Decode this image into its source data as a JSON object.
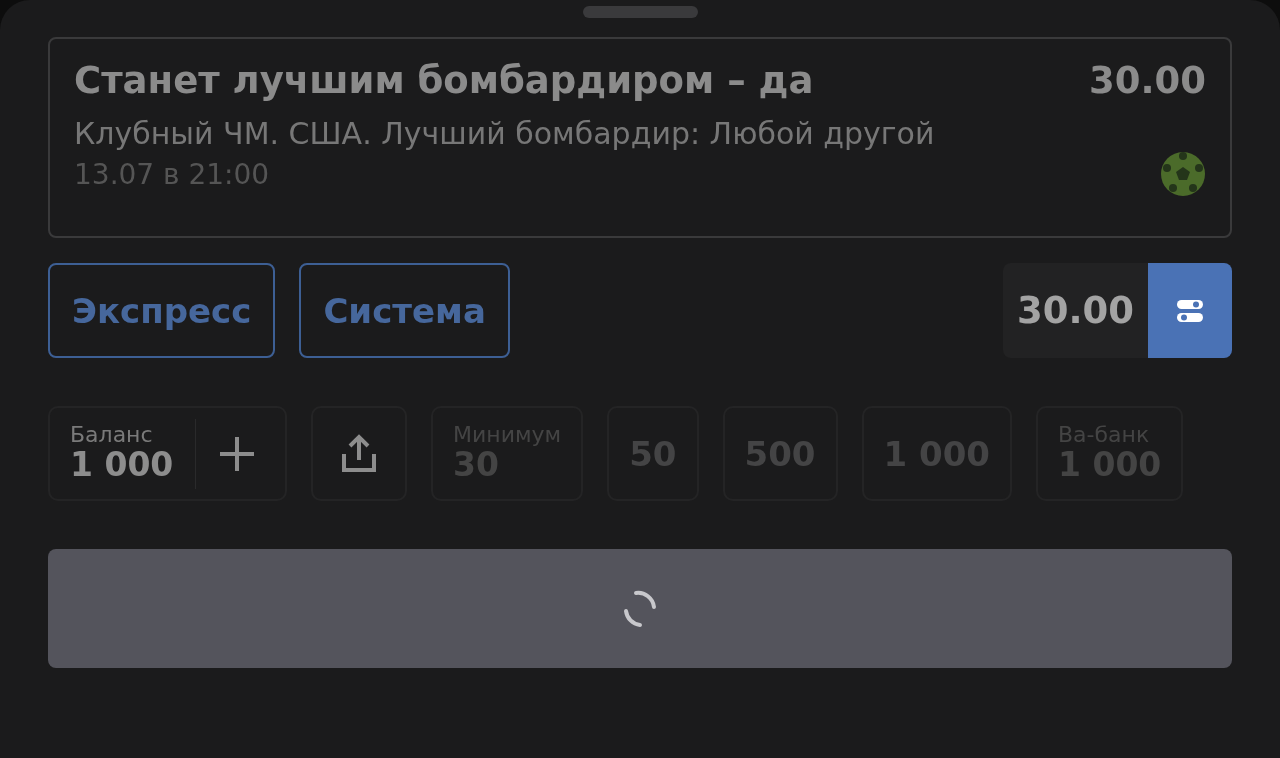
{
  "bet": {
    "title": "Станет лучшим бомбардиром – да",
    "odds": "30.00",
    "event": "Клубный ЧМ. США. Лучший бомбардир: Любой другой",
    "time": "13.07 в 21:00"
  },
  "bet_types": [
    {
      "label": "Экспресс",
      "selected": false
    },
    {
      "label": "Система",
      "selected": false
    }
  ],
  "total_odds": "30.00",
  "stake_chips": [
    {
      "kind": "balance",
      "label": "Баланс",
      "value": "1 000"
    },
    {
      "kind": "share"
    },
    {
      "kind": "labeled",
      "label": "Минимум",
      "value": "30"
    },
    {
      "kind": "amount",
      "value": "50"
    },
    {
      "kind": "amount",
      "value": "500"
    },
    {
      "kind": "amount",
      "value": "1 000"
    },
    {
      "kind": "labeled",
      "label": "Ва-банк",
      "value": "1 000"
    }
  ],
  "submit": {
    "loading": true
  }
}
